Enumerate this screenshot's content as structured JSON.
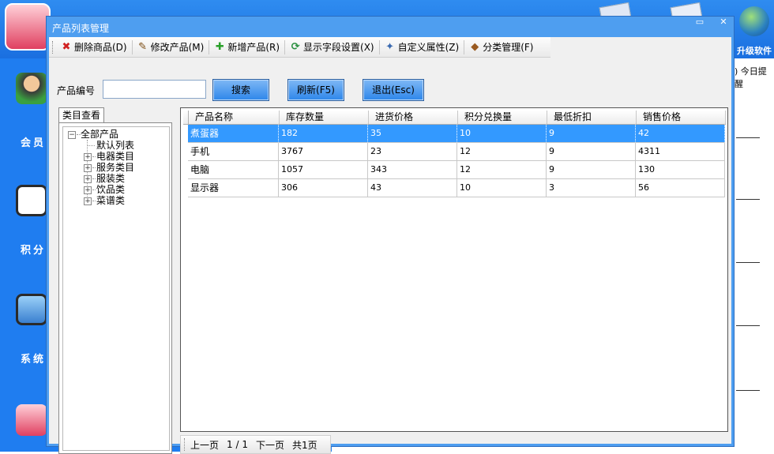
{
  "window": {
    "title": "产品列表管理",
    "min_btn": "▭",
    "close_btn": "✕"
  },
  "background": {
    "upgrade_label": "升级软件",
    "today_label": ") 今日提醒",
    "side_labels": [
      "会员",
      "积分",
      "系统"
    ]
  },
  "toolbar": {
    "items": [
      {
        "label": "删除商品(D)",
        "icon": "red-x-icon",
        "glyph": "✖",
        "color": "#d02020"
      },
      {
        "label": "修改产品(M)",
        "icon": "brush-icon",
        "glyph": "✎",
        "color": "#7a4a10"
      },
      {
        "label": "新增产品(R)",
        "icon": "green-plus-icon",
        "glyph": "✚",
        "color": "#2aa02a"
      },
      {
        "label": "显示字段设置(X)",
        "icon": "refresh-arrows-icon",
        "glyph": "⟳",
        "color": "#2a9040"
      },
      {
        "label": "自定义属性(Z)",
        "icon": "properties-icon",
        "glyph": "✦",
        "color": "#3a6ab0"
      },
      {
        "label": "分类管理(F)",
        "icon": "box-icon",
        "glyph": "◆",
        "color": "#9a5a20"
      }
    ]
  },
  "search": {
    "label": "产品编号",
    "value": "",
    "search_btn": "搜索",
    "refresh_btn": "刷新(F5)",
    "exit_btn": "退出(Esc)"
  },
  "category": {
    "tab_label": "类目查看",
    "root": "全部产品",
    "root_toggle": "−",
    "children": [
      {
        "label": "默认列表",
        "expandable": false
      },
      {
        "label": "电器类目",
        "expandable": true
      },
      {
        "label": "服务类目",
        "expandable": true
      },
      {
        "label": "服装类",
        "expandable": true
      },
      {
        "label": "饮品类",
        "expandable": true
      },
      {
        "label": "菜谱类",
        "expandable": true
      }
    ],
    "expand_glyph": "+"
  },
  "table": {
    "columns": [
      "产品名称",
      "库存数量",
      "进货价格",
      "积分兑换量",
      "最低折扣",
      "销售价格"
    ],
    "rows": [
      [
        "煮蛋器",
        "182",
        "35",
        "10",
        "9",
        "42"
      ],
      [
        "手机",
        "3767",
        "23",
        "12",
        "9",
        "4311"
      ],
      [
        "电脑",
        "1057",
        "343",
        "12",
        "9",
        "130"
      ],
      [
        "显示器",
        "306",
        "43",
        "10",
        "3",
        "56"
      ]
    ],
    "selected_row": 0
  },
  "pager": {
    "prev": "上一页",
    "page": "1 / 1",
    "next": "下一页",
    "total": "共1页"
  }
}
